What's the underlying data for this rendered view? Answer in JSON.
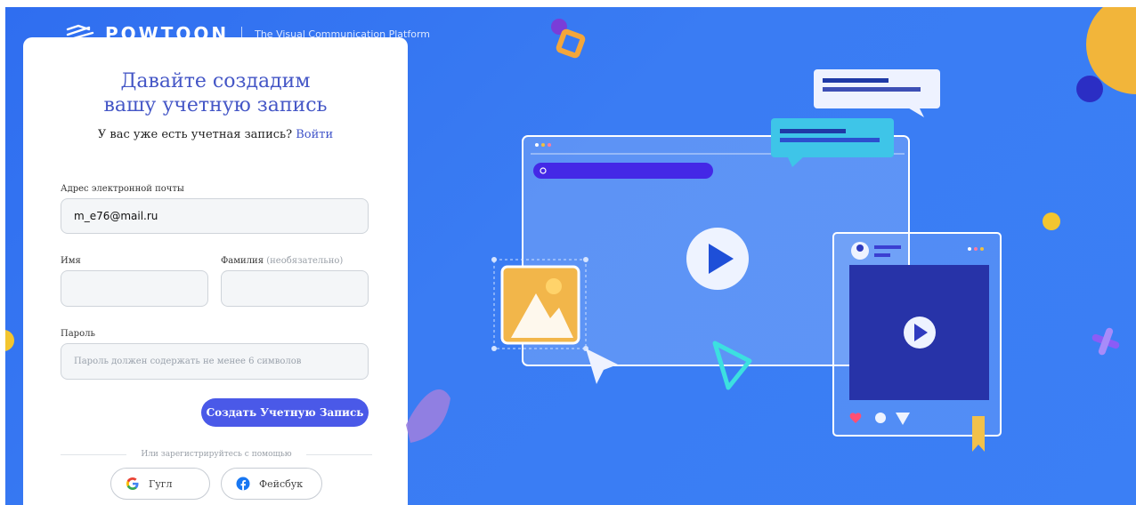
{
  "brand": {
    "name": "POWTOON",
    "tagline": "The Visual Communication Platform"
  },
  "signup": {
    "title": "Давайте создадим вашу учетную запись",
    "have_account_text": "У вас уже есть учетная запись?",
    "login_link": "Войти",
    "email_label": "Адрес электронной почты",
    "email_value": "m_e76@mail.ru",
    "first_name_label": "Имя",
    "last_name_label": "Фамилия",
    "last_name_optional": "(необязательно)",
    "first_name_value": "",
    "last_name_value": "",
    "password_label": "Пароль",
    "password_placeholder": "Пароль должен содержать не менее 6 символов",
    "create_button": "Создать Учетную Запись",
    "or_signup_with": "Или зарегистрируйтесь с помощью",
    "google_button": "Гугл",
    "facebook_button": "Фейсбук"
  },
  "colors": {
    "accent": "#4a59e8",
    "background": "#3a7cf3",
    "title": "#4456c6"
  },
  "icons": [
    "powtoon-logo-icon",
    "google-icon",
    "facebook-icon",
    "play-icon",
    "image-icon",
    "cursor-icon",
    "search-icon",
    "avatar-icon",
    "heart-icon",
    "send-icon",
    "bookmark-icon"
  ]
}
